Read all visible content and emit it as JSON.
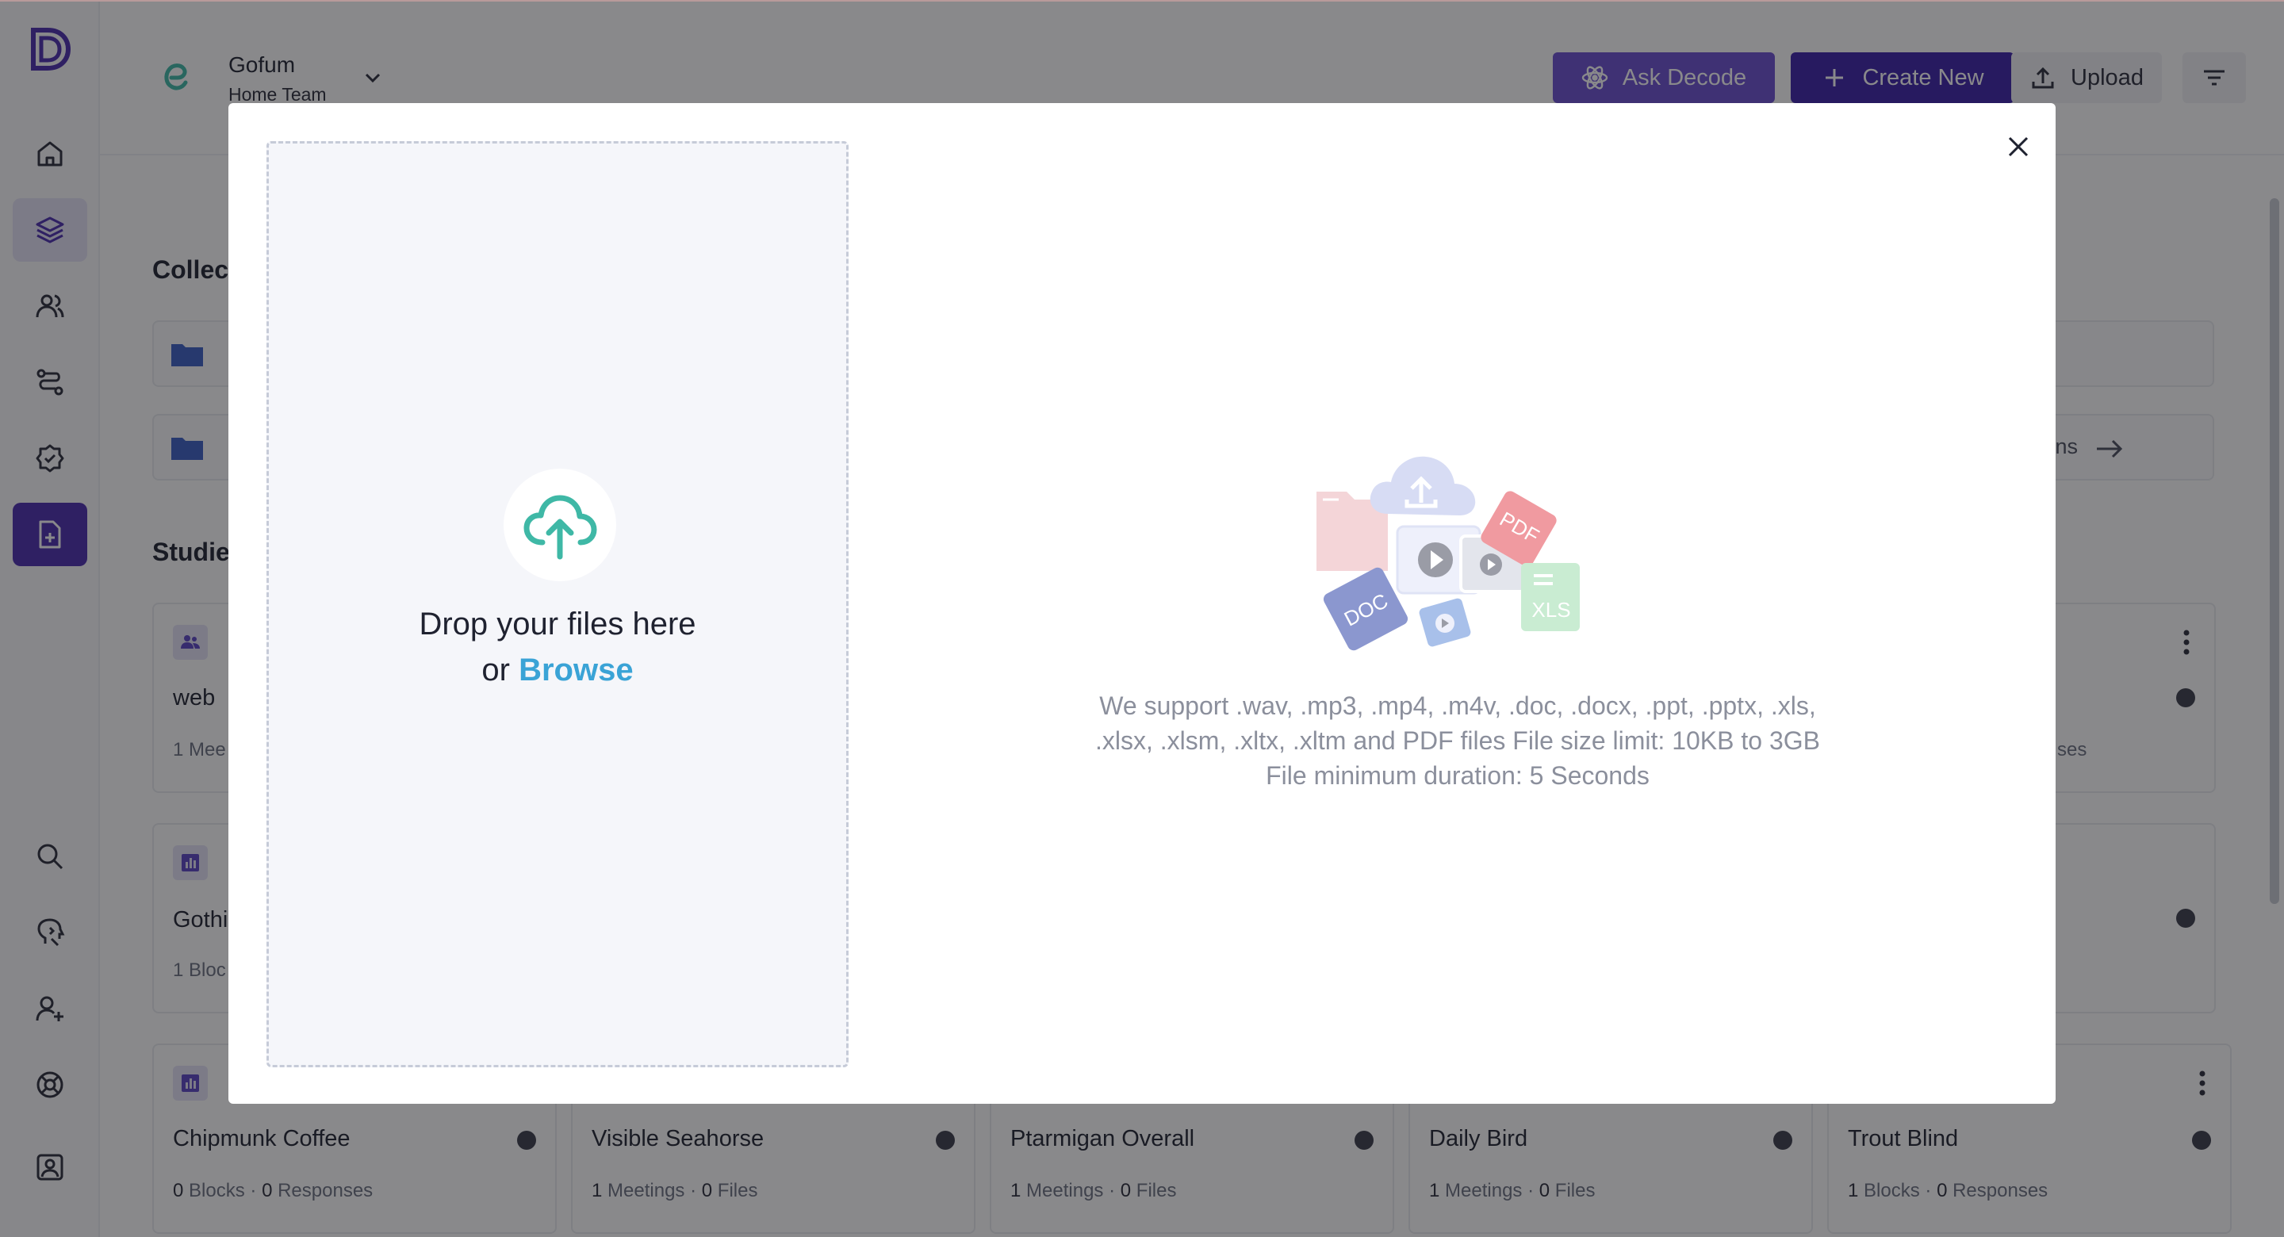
{
  "app": {
    "logo_letter": "D"
  },
  "sidebar": {
    "items": [
      {
        "name": "home",
        "icon": "home-icon"
      },
      {
        "name": "library",
        "icon": "layers-icon",
        "active": true
      },
      {
        "name": "people",
        "icon": "users-icon"
      },
      {
        "name": "routes",
        "icon": "route-icon"
      },
      {
        "name": "tasks",
        "icon": "check-circle-icon"
      },
      {
        "name": "new-file",
        "icon": "file-plus-icon",
        "primary": true
      },
      {
        "name": "search",
        "icon": "search-icon"
      },
      {
        "name": "ai-assist",
        "icon": "brain-icon"
      },
      {
        "name": "invite",
        "icon": "user-plus-icon"
      },
      {
        "name": "help",
        "icon": "lifebuoy-icon"
      },
      {
        "name": "profile",
        "icon": "user-square-icon"
      }
    ]
  },
  "header": {
    "workspace_name": "Gofum",
    "team_name": "Home Team",
    "ask_label": "Ask Decode",
    "create_label": "Create New",
    "upload_label": "Upload"
  },
  "main": {
    "collections_title": "Collections",
    "collections_title_visible": "Collec",
    "collections_link_visible": "ons",
    "studies_title": "Studies",
    "studies_title_visible": "Studie",
    "cards_row1": [
      {
        "title": "web ",
        "stat_visible": "1  Mee"
      },
      {
        "title": "",
        "stat_visible": "ses"
      }
    ],
    "cards_row2": [
      {
        "title": "Gothi",
        "stat_visible": "1  Bloc"
      }
    ],
    "cards_row3": [
      {
        "title": "Chipmunk Coffee",
        "n1": "0",
        "u1": "Blocks",
        "n2": "0",
        "u2": "Responses"
      },
      {
        "title": "Visible Seahorse",
        "n1": "1",
        "u1": "Meetings",
        "n2": "0",
        "u2": "Files"
      },
      {
        "title": "Ptarmigan Overall",
        "n1": "1",
        "u1": "Meetings",
        "n2": "0",
        "u2": "Files"
      },
      {
        "title": "Daily Bird",
        "n1": "1",
        "u1": "Meetings",
        "n2": "0",
        "u2": "Files"
      },
      {
        "title": "Trout Blind",
        "n1": "1",
        "u1": "Blocks",
        "n2": "0",
        "u2": "Responses"
      }
    ],
    "separator": "·"
  },
  "modal": {
    "drop_text": "Drop your files here",
    "or_text": "or",
    "browse_label": "Browse",
    "support_text": "We support .wav, .mp3, .mp4, .m4v, .doc, .docx, .ppt, .pptx, .xls, .xlsx, .xlsm, .xltx, .xltm and PDF files File size limit: 10KB to 3GB File minimum duration: 5 Seconds",
    "illustration_labels": {
      "pdf": "PDF",
      "doc": "DOC",
      "xls": "XLS"
    }
  },
  "colors": {
    "brand_primary": "#3b21a8",
    "brand_secondary": "#6a4ed1",
    "browse_link": "#3aa3d6",
    "upload_cloud": "#3fb8a6"
  }
}
